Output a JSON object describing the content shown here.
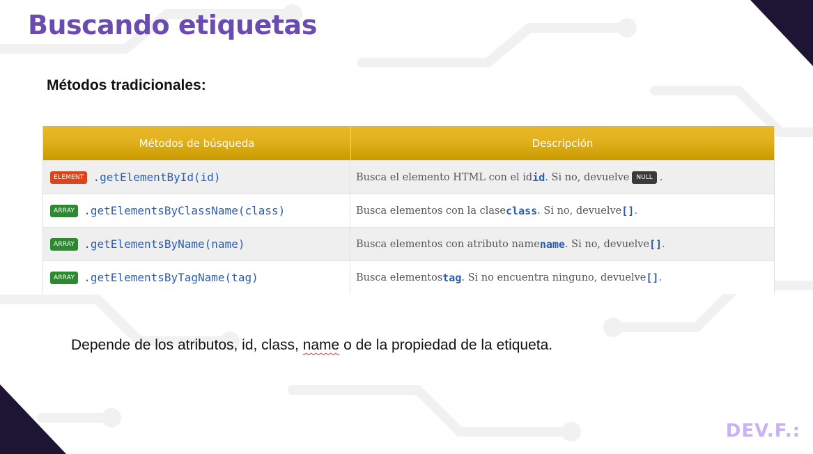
{
  "slide": {
    "title": "Buscando etiquetas",
    "subtitle": "Métodos tradicionales:",
    "footer_note": {
      "before": "Depende de los atributos, id, class, ",
      "flagged_word": "name",
      "after": " o de la propiedad de la etiqueta."
    },
    "logo": "DEV.F.:"
  },
  "table": {
    "headers": [
      "Métodos de búsqueda",
      "Descripción"
    ],
    "rows": [
      {
        "badge": "ELEMENT",
        "method": ".getElementById(id)",
        "desc_before": "Busca el elemento HTML con el id ",
        "desc_code": "id",
        "desc_middle": ". Si no, devuelve ",
        "desc_badge": "NULL",
        "desc_after": "."
      },
      {
        "badge": "ARRAY",
        "method": ".getElementsByClassName(class)",
        "desc_before": "Busca elementos con la clase ",
        "desc_code": "class",
        "desc_middle": ". Si no, devuelve ",
        "desc_result": "[]",
        "desc_after": "."
      },
      {
        "badge": "ARRAY",
        "method": ".getElementsByName(name)",
        "desc_before": "Busca elementos con atributo name ",
        "desc_code": "name",
        "desc_middle": ". Si no, devuelve ",
        "desc_result": "[]",
        "desc_after": "."
      },
      {
        "badge": "ARRAY",
        "method": ".getElementsByTagName(tag)",
        "desc_before": "Busca elementos ",
        "desc_code": "tag",
        "desc_middle": ". Si no encuentra ninguno, devuelve ",
        "desc_result": "[]",
        "desc_after": "."
      }
    ]
  },
  "colors": {
    "title": "#6a4bb0",
    "header_gold": "#e3b21f",
    "element_badge": "#d9451c",
    "array_badge": "#2b8a2e",
    "method_blue": "#2a5db0",
    "corner_dark": "#1e1433"
  }
}
